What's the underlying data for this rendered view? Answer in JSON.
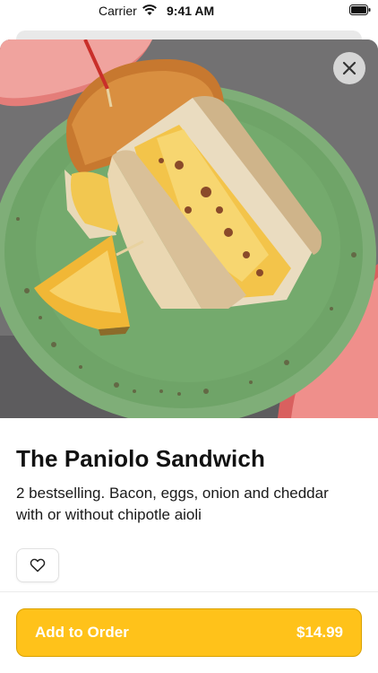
{
  "status_bar": {
    "carrier": "Carrier",
    "time": "9:41 AM"
  },
  "item": {
    "image_icon": "sandwich-photo",
    "title": "The Paniolo Sandwich",
    "description": "2 bestselling. Bacon, eggs, onion and cheddar with or without chipotle aioli"
  },
  "actions": {
    "close_icon": "close-icon",
    "favorite_icon": "heart-icon",
    "add_label": "Add to Order",
    "price": "$14.99"
  },
  "colors": {
    "accent": "#ffc21a",
    "accent_border": "#d9a100"
  }
}
